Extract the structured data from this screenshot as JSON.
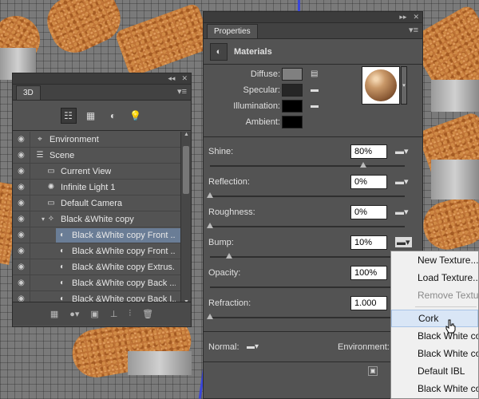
{
  "colors": {
    "panel_bg": "#535353",
    "selection": "#6a7d96",
    "menu_bg": "#f0f0f0",
    "cork": "#c07436",
    "viewport_line": "#3a46d8"
  },
  "panel3d": {
    "tab": "3D",
    "collapse_icon": "double-chevron-left-icon",
    "toolbar_icons": [
      "scene-filter-icon",
      "mesh-filter-icon",
      "material-filter-icon",
      "light-filter-icon"
    ],
    "layers": [
      {
        "label": "Environment",
        "icon": "environment-icon",
        "indent": 0
      },
      {
        "label": "Scene",
        "icon": "scene-icon",
        "indent": 0
      },
      {
        "label": "Current View",
        "icon": "camera-icon",
        "indent": 1
      },
      {
        "label": "Infinite Light 1",
        "icon": "light-icon",
        "indent": 1
      },
      {
        "label": "Default Camera",
        "icon": "camera-icon",
        "indent": 1
      },
      {
        "label": "Black &White copy",
        "icon": "mesh-icon",
        "indent": 1
      },
      {
        "label": "Black &White copy Front ...",
        "icon": "material-icon",
        "indent": 2
      },
      {
        "label": "Black &White copy Front ...",
        "icon": "material-icon",
        "indent": 2
      },
      {
        "label": "Black &White copy Extrus...",
        "icon": "material-icon",
        "indent": 2
      },
      {
        "label": "Black &White copy Back ...",
        "icon": "material-icon",
        "indent": 2
      },
      {
        "label": "Black &White copy Back I...",
        "icon": "material-icon",
        "indent": 2
      }
    ],
    "bottom_icons": [
      "add-mesh-icon",
      "add-light-icon",
      "render-icon",
      "ground-icon",
      "split-icon",
      "trash-icon"
    ]
  },
  "properties": {
    "tab": "Properties",
    "section": "Materials",
    "diffuse_label": "Diffuse:",
    "specular_label": "Specular:",
    "illumination_label": "Illumination:",
    "ambient_label": "Ambient:",
    "diffuse_color": "#808080",
    "specular_color": "#262626",
    "illumination_color": "#000000",
    "ambient_color": "#000000",
    "sliders": [
      {
        "label": "Shine:",
        "value": "80%",
        "fraction": 0.8
      },
      {
        "label": "Reflection:",
        "value": "0%",
        "fraction": 0
      },
      {
        "label": "Roughness:",
        "value": "0%",
        "fraction": 0
      },
      {
        "label": "Bump:",
        "value": "10%",
        "fraction": 0.1
      },
      {
        "label": "Opacity:",
        "value": "100%",
        "fraction": 1
      },
      {
        "label": "Refraction:",
        "value": "1.000",
        "fraction": 0
      }
    ],
    "normal_label": "Normal:",
    "environment_label": "Environment:"
  },
  "context_menu": {
    "items": [
      "New Texture...",
      "Load Texture...",
      "Remove Textur",
      "Cork",
      "Black White co",
      "Black White co",
      "Default IBL",
      "Black White co"
    ]
  }
}
